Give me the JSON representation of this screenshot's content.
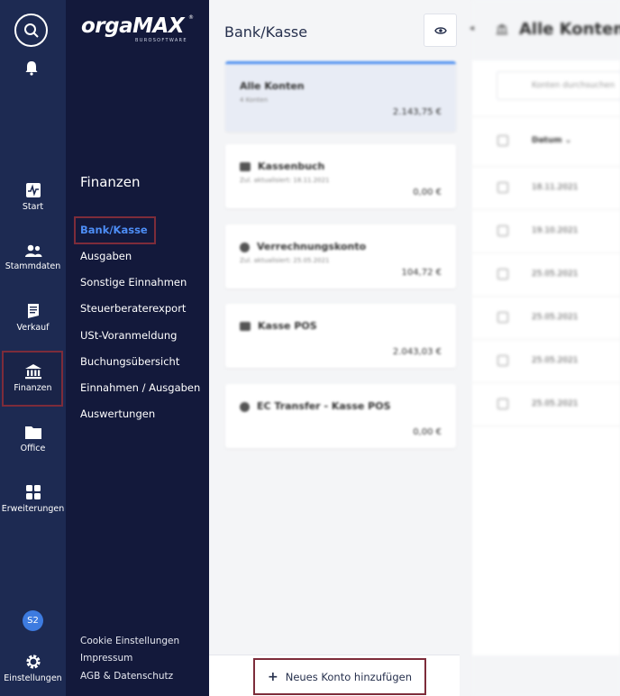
{
  "rail": {
    "items": [
      {
        "label": "Start",
        "icon": "activity-icon"
      },
      {
        "label": "Stammdaten",
        "icon": "people-icon"
      },
      {
        "label": "Verkauf",
        "icon": "receipt-icon"
      },
      {
        "label": "Finanzen",
        "icon": "bank-icon"
      },
      {
        "label": "Office",
        "icon": "folder-icon"
      },
      {
        "label": "Erweiterungen",
        "icon": "grid-icon"
      },
      {
        "label": "Einstellungen",
        "icon": "gear-icon"
      }
    ],
    "avatar_initials": "S2"
  },
  "brand": {
    "name": "orgaMAX",
    "tagline": "BUROSOFTWARE"
  },
  "subnav": {
    "title": "Finanzen",
    "items": [
      {
        "label": "Bank/Kasse"
      },
      {
        "label": "Ausgaben"
      },
      {
        "label": "Sonstige Einnahmen"
      },
      {
        "label": "Steuerberaterexport"
      },
      {
        "label": "USt-Voranmeldung"
      },
      {
        "label": "Buchungsübersicht"
      },
      {
        "label": "Einnahmen / Ausgaben"
      },
      {
        "label": "Auswertungen"
      }
    ],
    "footer": [
      {
        "label": "Cookie Einstellungen"
      },
      {
        "label": "Impressum"
      },
      {
        "label": "AGB & Datenschutz"
      }
    ]
  },
  "accounts": {
    "page_title": "Bank/Kasse",
    "cards": [
      {
        "name": "Alle Konten",
        "sub": "4 Konten",
        "amount": "2.143,75 €"
      },
      {
        "name": "Kassenbuch",
        "sub": "Zul. aktualisiert: 18.11.2021",
        "amount": "0,00 €"
      },
      {
        "name": "Verrechnungskonto",
        "sub": "Zul. aktualisiert: 25.05.2021",
        "amount": "104,72 €"
      },
      {
        "name": "Kasse POS",
        "sub": "",
        "amount": "2.043,03 €"
      },
      {
        "name": "EC Transfer - Kasse POS",
        "sub": "",
        "amount": "0,00 €"
      }
    ],
    "add_button_label": "Neues Konto hinzufügen"
  },
  "table": {
    "title": "Alle Konten",
    "search_placeholder": "Konten durchsuchen",
    "column_header": "Datum",
    "rows": [
      "18.11.2021",
      "19.10.2021",
      "25.05.2021",
      "25.05.2021",
      "25.05.2021",
      "25.05.2021"
    ]
  }
}
